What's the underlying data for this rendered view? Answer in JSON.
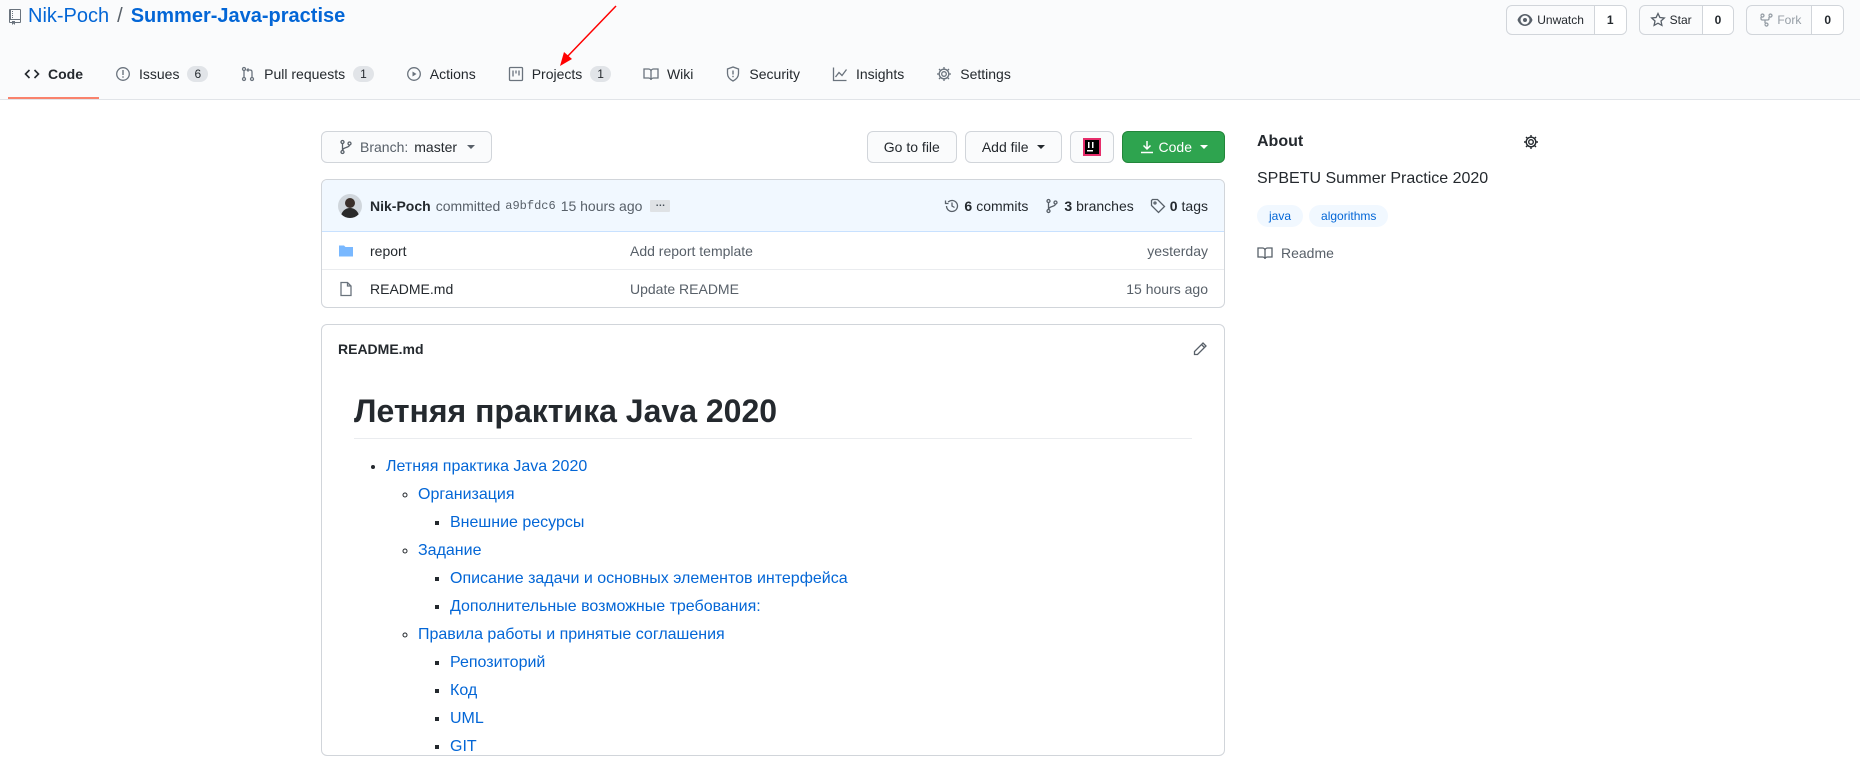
{
  "repo": {
    "owner": "Nik-Poch",
    "separator": "/",
    "name": "Summer-Java-practise"
  },
  "actions": {
    "unwatch": {
      "label": "Unwatch",
      "count": "1"
    },
    "star": {
      "label": "Star",
      "count": "0"
    },
    "fork": {
      "label": "Fork",
      "count": "0"
    }
  },
  "tabs": [
    {
      "label": "Code",
      "icon": "code-icon"
    },
    {
      "label": "Issues",
      "icon": "issue-icon",
      "count": "6"
    },
    {
      "label": "Pull requests",
      "icon": "pull-request-icon",
      "count": "1"
    },
    {
      "label": "Actions",
      "icon": "play-icon"
    },
    {
      "label": "Projects",
      "icon": "project-icon",
      "count": "1"
    },
    {
      "label": "Wiki",
      "icon": "book-icon"
    },
    {
      "label": "Security",
      "icon": "shield-icon"
    },
    {
      "label": "Insights",
      "icon": "graph-icon"
    },
    {
      "label": "Settings",
      "icon": "gear-icon"
    }
  ],
  "file_nav": {
    "branch_prefix": "Branch:",
    "branch_name": "master",
    "go_to_file": "Go to file",
    "add_file": "Add file",
    "code": "Code"
  },
  "commit": {
    "author": "Nik-Poch",
    "verb": "committed",
    "sha": "a9bfdc6",
    "age": "15 hours ago",
    "ellipsis": "…",
    "commits_count": "6",
    "commits_label": "commits",
    "branches_count": "3",
    "branches_label": "branches",
    "tags_count": "0",
    "tags_label": "tags"
  },
  "files": [
    {
      "name": "report",
      "message": "Add report template",
      "age": "yesterday",
      "icon": "folder-icon"
    },
    {
      "name": "README.md",
      "message": "Update README",
      "age": "15 hours ago",
      "icon": "file-icon"
    }
  ],
  "readme": {
    "filename": "README.md",
    "heading": "Летняя практика Java 2020",
    "toc": {
      "root": "Летняя практика Java 2020",
      "org": "Организация",
      "org_res": "Внешние ресурсы",
      "task": "Задание",
      "task_desc": "Описание задачи и основных элементов интерфейса",
      "task_extra": "Дополнительные возможные требования:",
      "rules": "Правила работы и принятые соглашения",
      "rules_repo": "Репозиторий",
      "rules_code": "Код",
      "rules_uml": "UML",
      "rules_git": "GIT"
    }
  },
  "about": {
    "title": "About",
    "description": "SPBETU Summer Practice 2020",
    "topics": [
      "java",
      "algorithms"
    ],
    "readme_label": "Readme"
  },
  "colors": {
    "accent": "#0366d6",
    "green": "#2ea44f",
    "tab_underline": "#f9826c",
    "annotation_arrow": "#ff0000"
  }
}
